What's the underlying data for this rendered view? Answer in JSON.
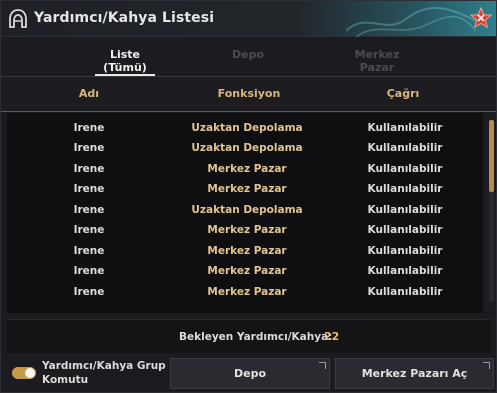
{
  "window": {
    "title": "Yardımcı/Kahya Listesi"
  },
  "tabs": [
    {
      "label": "Liste (Tümü)",
      "active": true
    },
    {
      "label": "Depo",
      "active": false
    },
    {
      "label": "Merkez Pazar",
      "active": false
    }
  ],
  "columns": {
    "name": "Adı",
    "function": "Fonksiyon",
    "call": "Çağrı"
  },
  "rows": [
    {
      "name": "Irene",
      "function": "Uzaktan Depolama",
      "call": "Kullanılabilir"
    },
    {
      "name": "Irene",
      "function": "Uzaktan Depolama",
      "call": "Kullanılabilir"
    },
    {
      "name": "Irene",
      "function": "Merkez Pazar",
      "call": "Kullanılabilir"
    },
    {
      "name": "Irene",
      "function": "Merkez Pazar",
      "call": "Kullanılabilir"
    },
    {
      "name": "Irene",
      "function": "Uzaktan Depolama",
      "call": "Kullanılabilir"
    },
    {
      "name": "Irene",
      "function": "Merkez Pazar",
      "call": "Kullanılabilir"
    },
    {
      "name": "Irene",
      "function": "Merkez Pazar",
      "call": "Kullanılabilir"
    },
    {
      "name": "Irene",
      "function": "Merkez Pazar",
      "call": "Kullanılabilir"
    },
    {
      "name": "Irene",
      "function": "Merkez Pazar",
      "call": "Kullanılabilir"
    }
  ],
  "waiting": {
    "label": "Bekleyen Yardımcı/Kahya:",
    "value": "22"
  },
  "footer": {
    "group_command_label": "Yardımcı/Kahya Grup Komutu",
    "group_command_on": true,
    "depo_button": "Depo",
    "market_button": "Merkez Pazarı Aç"
  },
  "colors": {
    "accent": "#d8b77b",
    "value": "#e2c06e",
    "toggle": "#c79a4a",
    "scrollbar": "#b58c56"
  },
  "icons": {
    "title": "helmet-icon",
    "close": "star-close-icon"
  }
}
